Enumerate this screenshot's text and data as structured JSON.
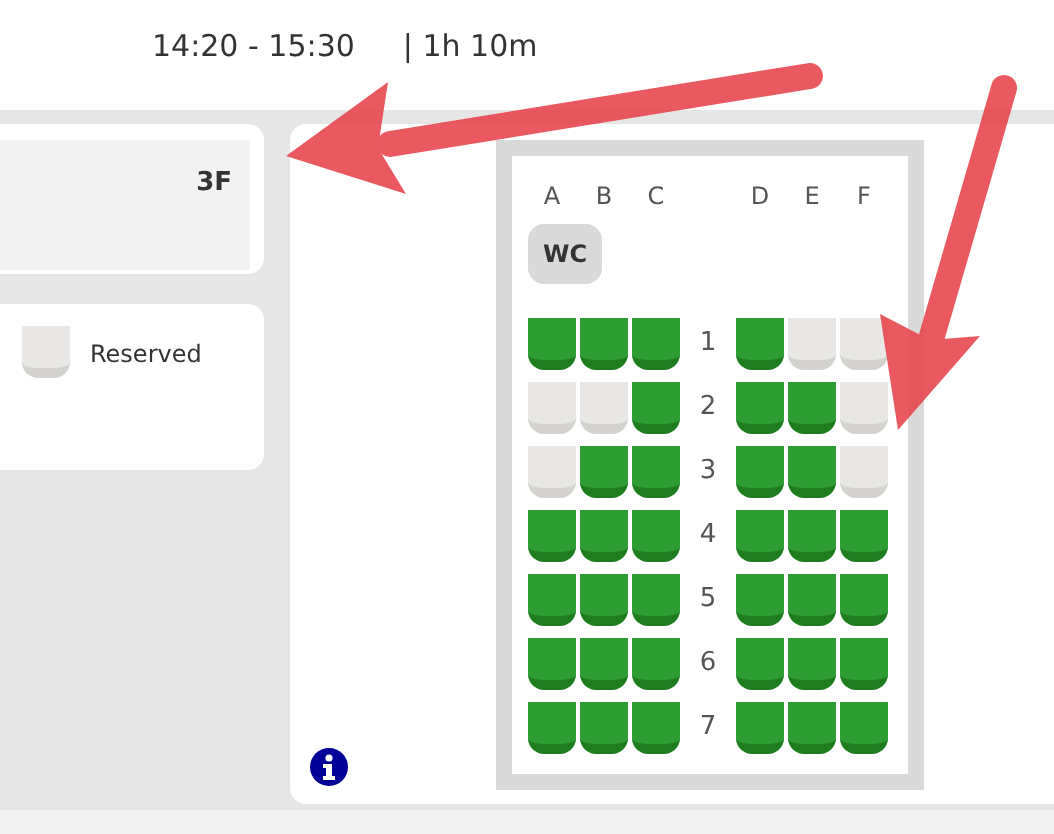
{
  "header": {
    "time": "14:20 - 15:30",
    "duration": "| 1h 10m"
  },
  "coach": {
    "label": "3F"
  },
  "legend": [
    {
      "kind": "reserved",
      "label": "Reserved"
    }
  ],
  "seat_map": {
    "columns": [
      "A",
      "B",
      "C",
      "D",
      "E",
      "F"
    ],
    "wc": "WC",
    "rows": [
      {
        "number": "1",
        "seats": [
          {
            "reserved": false
          },
          {
            "reserved": false
          },
          {
            "reserved": false
          },
          {
            "reserved": false
          },
          {
            "reserved": true
          },
          {
            "reserved": true
          }
        ]
      },
      {
        "number": "2",
        "seats": [
          {
            "reserved": true
          },
          {
            "reserved": true
          },
          {
            "reserved": false
          },
          {
            "reserved": false
          },
          {
            "reserved": false
          },
          {
            "reserved": true
          }
        ]
      },
      {
        "number": "3",
        "seats": [
          {
            "reserved": true
          },
          {
            "reserved": false
          },
          {
            "reserved": false
          },
          {
            "reserved": false
          },
          {
            "reserved": false
          },
          {
            "reserved": true
          }
        ]
      },
      {
        "number": "4",
        "seats": [
          {
            "reserved": false
          },
          {
            "reserved": false
          },
          {
            "reserved": false
          },
          {
            "reserved": false
          },
          {
            "reserved": false
          },
          {
            "reserved": false
          }
        ]
      },
      {
        "number": "5",
        "seats": [
          {
            "reserved": false
          },
          {
            "reserved": false
          },
          {
            "reserved": false
          },
          {
            "reserved": false
          },
          {
            "reserved": false
          },
          {
            "reserved": false
          }
        ]
      },
      {
        "number": "6",
        "seats": [
          {
            "reserved": false
          },
          {
            "reserved": false
          },
          {
            "reserved": false
          },
          {
            "reserved": false
          },
          {
            "reserved": false
          },
          {
            "reserved": false
          }
        ]
      },
      {
        "number": "7",
        "seats": [
          {
            "reserved": false
          },
          {
            "reserved": false
          },
          {
            "reserved": false
          },
          {
            "reserved": false
          },
          {
            "reserved": false
          },
          {
            "reserved": false
          }
        ]
      }
    ]
  }
}
